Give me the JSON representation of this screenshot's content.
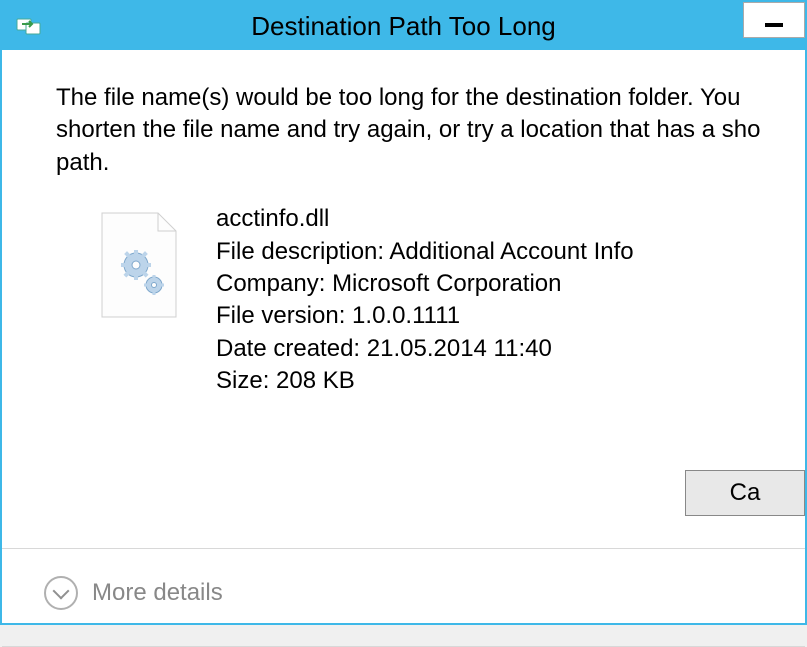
{
  "titlebar": {
    "title": "Destination Path Too Long"
  },
  "message": "The file name(s) would be too long for the destination folder. You shorten the file name and try again, or try a location that has a sho path.",
  "file": {
    "name": "acctinfo.dll",
    "description_label": "File description:",
    "description_value": "Additional Account Info",
    "company_label": "Company:",
    "company_value": "Microsoft Corporation",
    "version_label": "File version:",
    "version_value": "1.0.0.1111",
    "date_label": "Date created:",
    "date_value": "21.05.2014 11:40",
    "size_label": "Size:",
    "size_value": "208 KB"
  },
  "buttons": {
    "cancel": "Ca"
  },
  "more_details": {
    "label": "More details"
  }
}
